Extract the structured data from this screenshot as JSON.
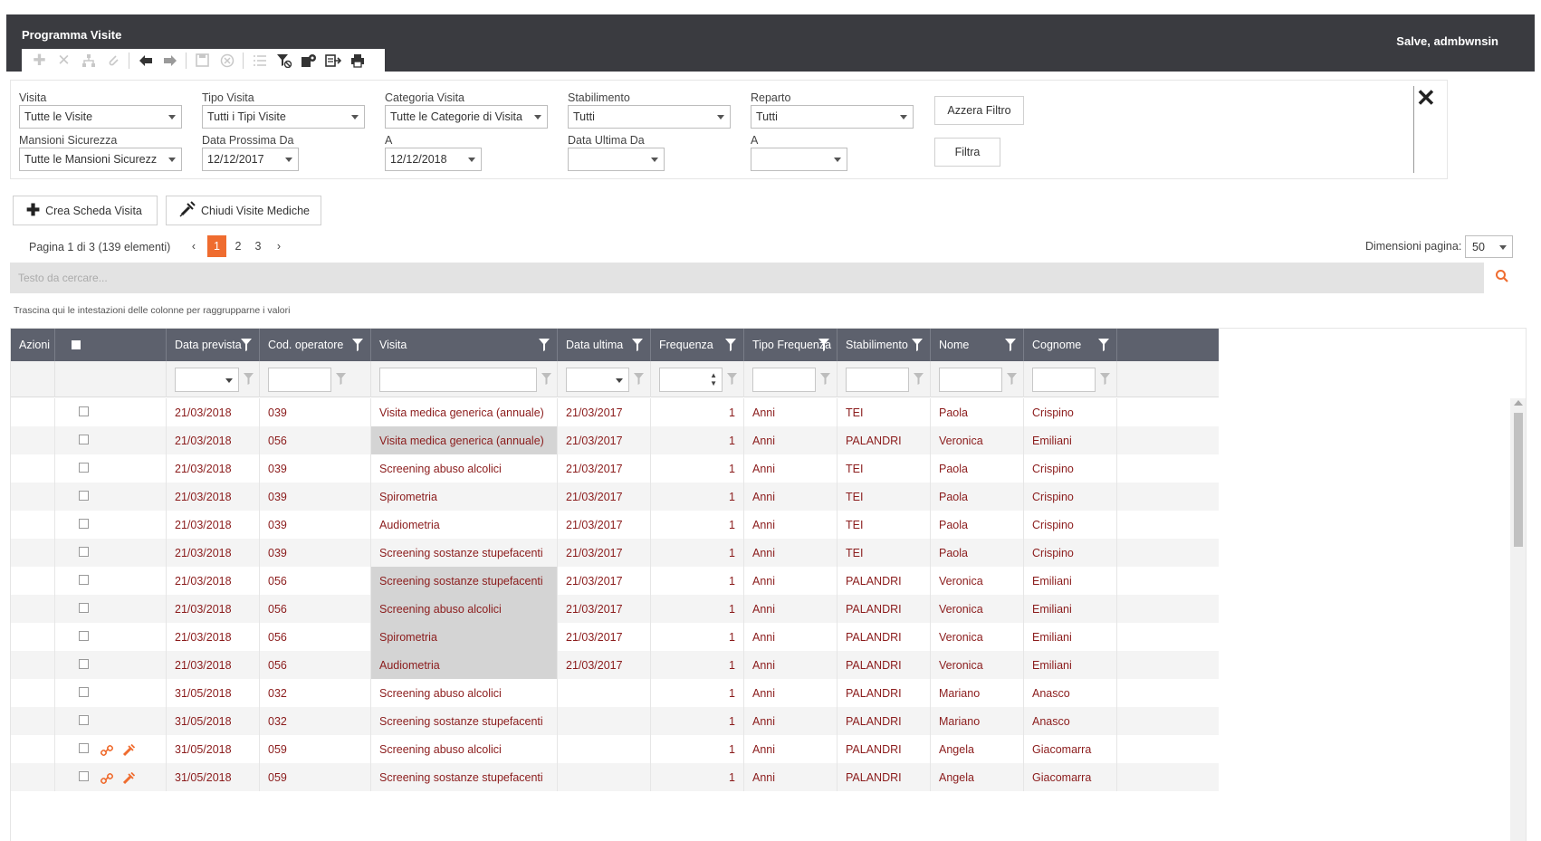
{
  "app": {
    "title": "Programma Visite",
    "greeting": "Salve, admbwnsin"
  },
  "toolbar": {
    "icons": [
      "plus-icon",
      "x-icon",
      "hierarchy-icon",
      "attach-icon",
      "arrow-left-icon",
      "arrow-right-icon",
      "save-icon",
      "cancel-icon",
      "list-icon",
      "filter-clear-icon",
      "settings-icon",
      "export-icon",
      "print-icon"
    ]
  },
  "filters": {
    "visita": {
      "label": "Visita",
      "value": "Tutte le Visite"
    },
    "tipo_visita": {
      "label": "Tipo Visita",
      "value": "Tutti i Tipi Visite"
    },
    "categoria_visita": {
      "label": "Categoria Visita",
      "value": "Tutte le Categorie di Visita"
    },
    "stabilimento": {
      "label": "Stabilimento",
      "value": "Tutti"
    },
    "reparto": {
      "label": "Reparto",
      "value": "Tutti"
    },
    "mansioni": {
      "label": "Mansioni Sicurezza",
      "value": "Tutte le Mansioni Sicurezz"
    },
    "data_prossima_da": {
      "label": "Data Prossima Da",
      "value": "12/12/2017"
    },
    "data_prossima_a": {
      "label": "A",
      "value": "12/12/2018"
    },
    "data_ultima_da": {
      "label": "Data Ultima Da",
      "value": ""
    },
    "data_ultima_a": {
      "label": "A",
      "value": ""
    },
    "reset_label": "Azzera Filtro",
    "apply_label": "Filtra"
  },
  "actions": {
    "create_label": "Crea Scheda Visita",
    "close_label": "Chiudi Visite Mediche"
  },
  "pager": {
    "info": "Pagina 1 di 3 (139 elementi)",
    "pages": [
      "1",
      "2",
      "3"
    ],
    "current": "1",
    "page_size_label": "Dimensioni pagina:",
    "page_size": "50"
  },
  "search": {
    "placeholder": "Testo da cercare..."
  },
  "group_hint": "Trascina qui le intestazioni delle colonne per raggrupparne i valori",
  "grid": {
    "columns": [
      "Azioni",
      "",
      "Data prevista",
      "Cod. operatore",
      "Visita",
      "Data ultima",
      "Frequenza",
      "Tipo Frequenza",
      "Stabilimento",
      "Nome",
      "Cognome"
    ],
    "rows": [
      {
        "data_prevista": "21/03/2018",
        "cod": "039",
        "visita": "Visita medica generica (annuale)",
        "data_ultima": "21/03/2017",
        "freq": "1",
        "tipo": "Anni",
        "stab": "TEI",
        "nome": "Paola",
        "cognome": "Crispino",
        "hl": false,
        "icons": false
      },
      {
        "data_prevista": "21/03/2018",
        "cod": "056",
        "visita": "Visita medica generica (annuale)",
        "data_ultima": "21/03/2017",
        "freq": "1",
        "tipo": "Anni",
        "stab": "PALANDRI",
        "nome": "Veronica",
        "cognome": "Emiliani",
        "hl": true,
        "icons": false
      },
      {
        "data_prevista": "21/03/2018",
        "cod": "039",
        "visita": "Screening abuso alcolici",
        "data_ultima": "21/03/2017",
        "freq": "1",
        "tipo": "Anni",
        "stab": "TEI",
        "nome": "Paola",
        "cognome": "Crispino",
        "hl": false,
        "icons": false
      },
      {
        "data_prevista": "21/03/2018",
        "cod": "039",
        "visita": "Spirometria",
        "data_ultima": "21/03/2017",
        "freq": "1",
        "tipo": "Anni",
        "stab": "TEI",
        "nome": "Paola",
        "cognome": "Crispino",
        "hl": false,
        "icons": false
      },
      {
        "data_prevista": "21/03/2018",
        "cod": "039",
        "visita": "Audiometria",
        "data_ultima": "21/03/2017",
        "freq": "1",
        "tipo": "Anni",
        "stab": "TEI",
        "nome": "Paola",
        "cognome": "Crispino",
        "hl": false,
        "icons": false
      },
      {
        "data_prevista": "21/03/2018",
        "cod": "039",
        "visita": "Screening sostanze stupefacenti",
        "data_ultima": "21/03/2017",
        "freq": "1",
        "tipo": "Anni",
        "stab": "TEI",
        "nome": "Paola",
        "cognome": "Crispino",
        "hl": false,
        "icons": false
      },
      {
        "data_prevista": "21/03/2018",
        "cod": "056",
        "visita": "Screening sostanze stupefacenti",
        "data_ultima": "21/03/2017",
        "freq": "1",
        "tipo": "Anni",
        "stab": "PALANDRI",
        "nome": "Veronica",
        "cognome": "Emiliani",
        "hl": true,
        "icons": false
      },
      {
        "data_prevista": "21/03/2018",
        "cod": "056",
        "visita": "Screening abuso alcolici",
        "data_ultima": "21/03/2017",
        "freq": "1",
        "tipo": "Anni",
        "stab": "PALANDRI",
        "nome": "Veronica",
        "cognome": "Emiliani",
        "hl": true,
        "icons": false
      },
      {
        "data_prevista": "21/03/2018",
        "cod": "056",
        "visita": "Spirometria",
        "data_ultima": "21/03/2017",
        "freq": "1",
        "tipo": "Anni",
        "stab": "PALANDRI",
        "nome": "Veronica",
        "cognome": "Emiliani",
        "hl": true,
        "icons": false
      },
      {
        "data_prevista": "21/03/2018",
        "cod": "056",
        "visita": "Audiometria",
        "data_ultima": "21/03/2017",
        "freq": "1",
        "tipo": "Anni",
        "stab": "PALANDRI",
        "nome": "Veronica",
        "cognome": "Emiliani",
        "hl": true,
        "icons": false
      },
      {
        "data_prevista": "31/05/2018",
        "cod": "032",
        "visita": "Screening abuso alcolici",
        "data_ultima": "",
        "freq": "1",
        "tipo": "Anni",
        "stab": "PALANDRI",
        "nome": "Mariano",
        "cognome": "Anasco",
        "hl": false,
        "icons": false
      },
      {
        "data_prevista": "31/05/2018",
        "cod": "032",
        "visita": "Screening sostanze stupefacenti",
        "data_ultima": "",
        "freq": "1",
        "tipo": "Anni",
        "stab": "PALANDRI",
        "nome": "Mariano",
        "cognome": "Anasco",
        "hl": false,
        "icons": false
      },
      {
        "data_prevista": "31/05/2018",
        "cod": "059",
        "visita": "Screening abuso alcolici",
        "data_ultima": "",
        "freq": "1",
        "tipo": "Anni",
        "stab": "PALANDRI",
        "nome": "Angela",
        "cognome": "Giacomarra",
        "hl": false,
        "icons": true
      },
      {
        "data_prevista": "31/05/2018",
        "cod": "059",
        "visita": "Screening sostanze stupefacenti",
        "data_ultima": "",
        "freq": "1",
        "tipo": "Anni",
        "stab": "PALANDRI",
        "nome": "Angela",
        "cognome": "Giacomarra",
        "hl": false,
        "icons": true
      }
    ]
  },
  "colors": {
    "header_bg": "#3a3b40",
    "grid_header_bg": "#5d616d",
    "accent": "#ef6c2f",
    "row_text": "#8b1c1c",
    "highlight": "#d4d4d4"
  }
}
